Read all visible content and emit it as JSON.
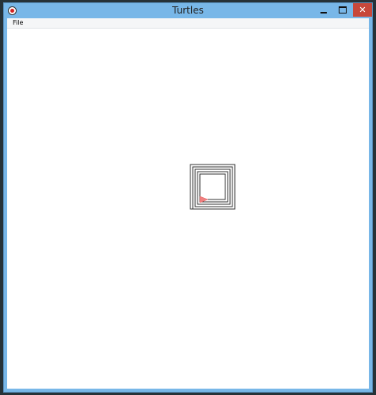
{
  "window": {
    "title": "Turtles"
  },
  "menu": {
    "file_label": "File"
  },
  "controls": {
    "close_glyph": "✕"
  },
  "colors": {
    "window_border": "#78b7e8",
    "close_button": "#c7473a",
    "turtle": "#f08080",
    "trail": "#333333"
  },
  "icons": {
    "app": "turtle-app-icon",
    "minimize": "minimize-icon",
    "maximize": "maximize-icon",
    "close": "close-icon",
    "turtle": "turtle-cursor-icon"
  }
}
